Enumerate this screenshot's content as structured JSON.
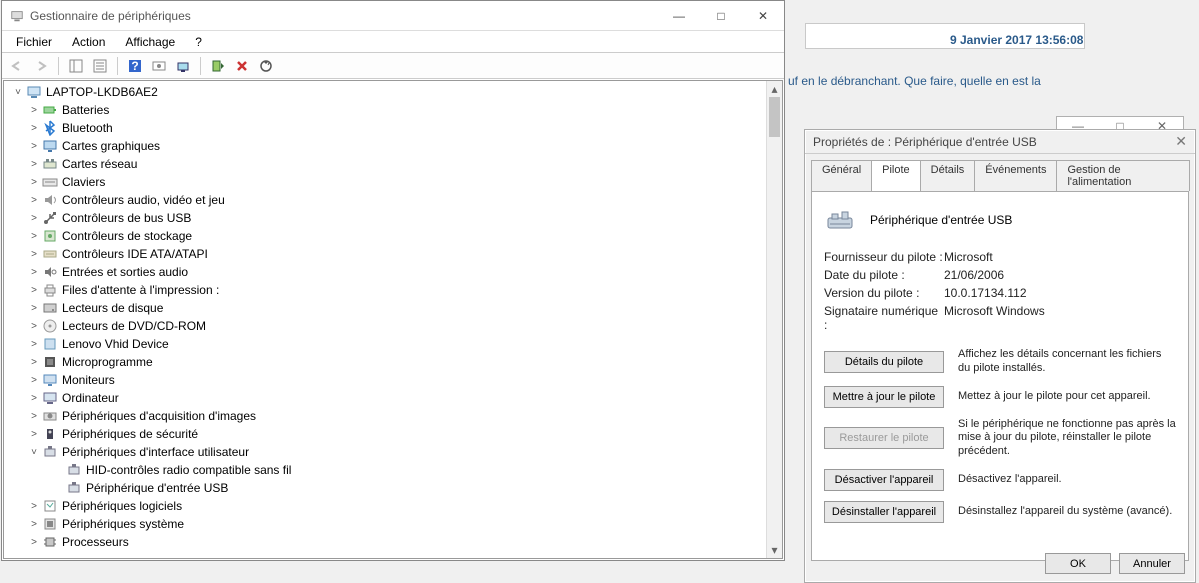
{
  "bg": {
    "date": "9 Janvier 2017 13:56:08",
    "text": "uf en le débranchant. Que faire, quelle en est la",
    "la": "la"
  },
  "devmgr": {
    "title": "Gestionnaire de périphériques",
    "menu": {
      "file": "Fichier",
      "action": "Action",
      "view": "Affichage",
      "help": "?"
    },
    "tree": {
      "root": "LAPTOP-LKDB6AE2",
      "items": [
        {
          "label": "Batteries",
          "icon": "battery"
        },
        {
          "label": "Bluetooth",
          "icon": "bt"
        },
        {
          "label": "Cartes graphiques",
          "icon": "display"
        },
        {
          "label": "Cartes réseau",
          "icon": "net"
        },
        {
          "label": "Claviers",
          "icon": "kbd"
        },
        {
          "label": "Contrôleurs audio, vidéo et jeu",
          "icon": "audio"
        },
        {
          "label": "Contrôleurs de bus USB",
          "icon": "usb"
        },
        {
          "label": "Contrôleurs de stockage",
          "icon": "storage"
        },
        {
          "label": "Contrôleurs IDE ATA/ATAPI",
          "icon": "ide"
        },
        {
          "label": "Entrées et sorties audio",
          "icon": "io"
        },
        {
          "label": "Files d'attente à l'impression :",
          "icon": "print"
        },
        {
          "label": "Lecteurs de disque",
          "icon": "disk"
        },
        {
          "label": "Lecteurs de DVD/CD-ROM",
          "icon": "cd"
        },
        {
          "label": "Lenovo Vhid Device",
          "icon": "generic"
        },
        {
          "label": "Microprogramme",
          "icon": "firmware"
        },
        {
          "label": "Moniteurs",
          "icon": "monitor"
        },
        {
          "label": "Ordinateur",
          "icon": "computer"
        },
        {
          "label": "Périphériques d'acquisition d'images",
          "icon": "camera"
        },
        {
          "label": "Périphériques de sécurité",
          "icon": "security"
        },
        {
          "label": "Périphériques d'interface utilisateur",
          "icon": "hid",
          "expanded": true,
          "children": [
            {
              "label": "HID-contrôles radio compatible sans fil",
              "icon": "hidchild"
            },
            {
              "label": "Périphérique d'entrée USB",
              "icon": "hidchild"
            }
          ]
        },
        {
          "label": "Périphériques logiciels",
          "icon": "soft"
        },
        {
          "label": "Périphériques système",
          "icon": "sys"
        },
        {
          "label": "Processeurs",
          "icon": "cpu"
        }
      ]
    }
  },
  "props": {
    "title": "Propriétés de : Périphérique d'entrée USB",
    "device_name": "Périphérique d'entrée USB",
    "tabs": {
      "general": "Général",
      "driver": "Pilote",
      "details": "Détails",
      "events": "Événements",
      "power": "Gestion de l'alimentation"
    },
    "fields": {
      "vendor_k": "Fournisseur du pilote :",
      "vendor_v": "Microsoft",
      "date_k": "Date du pilote :",
      "date_v": "21/06/2006",
      "ver_k": "Version du pilote :",
      "ver_v": "10.0.17134.112",
      "signer_k": "Signataire numérique :",
      "signer_v": "Microsoft Windows"
    },
    "buttons": {
      "details": "Détails du pilote",
      "details_desc": "Affichez les détails concernant les fichiers du pilote installés.",
      "update": "Mettre à jour le pilote",
      "update_desc": "Mettez à jour le pilote pour cet appareil.",
      "restore": "Restaurer le pilote",
      "restore_desc": "Si le périphérique ne fonctionne pas après la mise à jour du pilote, réinstaller le pilote précédent.",
      "disable": "Désactiver l'appareil",
      "disable_desc": "Désactivez l'appareil.",
      "uninstall": "Désinstaller l'appareil",
      "uninstall_desc": "Désinstallez l'appareil du système (avancé)."
    },
    "ok": "OK",
    "cancel": "Annuler"
  }
}
